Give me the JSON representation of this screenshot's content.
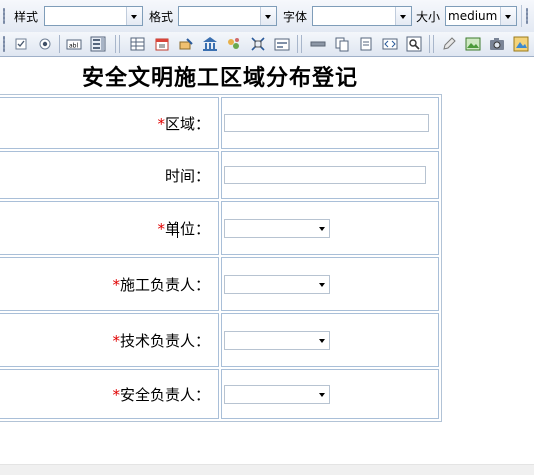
{
  "toolbar": {
    "style_label": "样式",
    "style_value": "",
    "format_label": "格式",
    "format_value": "",
    "font_label": "字体",
    "font_value": "",
    "size_label": "大小",
    "size_value": "medium"
  },
  "toolbar_icons": [
    "checkbox-icon",
    "radio-icon",
    "textfield-icon",
    "listbox-icon",
    "table-icon",
    "calendar-icon",
    "tools-icon",
    "bank-icon",
    "link-icon",
    "anchor-icon",
    "form-icon",
    "hr-icon",
    "copy-icon",
    "page-icon",
    "code-icon",
    "preview-icon",
    "edit-icon",
    "image-icon",
    "camera-icon",
    "media-icon"
  ],
  "document": {
    "title": "安全文明施工区域分布登记",
    "fields": [
      {
        "required": true,
        "label": "区域：",
        "type": "text",
        "value": ""
      },
      {
        "required": false,
        "label": "时间：",
        "type": "text",
        "value": ""
      },
      {
        "required": true,
        "label": "单位：",
        "type": "select",
        "value": ""
      },
      {
        "required": true,
        "label": "施工负责人：",
        "type": "select",
        "value": ""
      },
      {
        "required": true,
        "label": "技术负责人：",
        "type": "select",
        "value": ""
      },
      {
        "required": true,
        "label": "安全负责人：",
        "type": "select",
        "value": ""
      }
    ],
    "required_mark": "*"
  }
}
